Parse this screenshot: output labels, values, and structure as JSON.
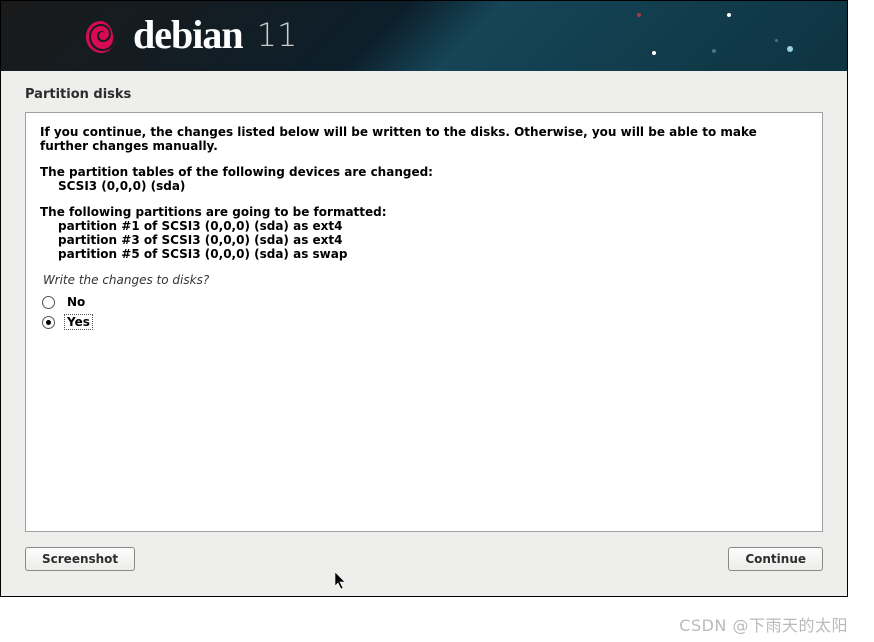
{
  "brand": {
    "name": "debian",
    "version": "11"
  },
  "page": {
    "title": "Partition disks"
  },
  "panel": {
    "warning": "If you continue, the changes listed below will be written to the disks. Otherwise, you will be able to make further changes manually.",
    "tables_heading": "The partition tables of the following devices are changed:",
    "tables": [
      "SCSI3 (0,0,0) (sda)"
    ],
    "format_heading": "The following partitions are going to be formatted:",
    "format_items": [
      "partition #1 of SCSI3 (0,0,0) (sda) as ext4",
      "partition #3 of SCSI3 (0,0,0) (sda) as ext4",
      "partition #5 of SCSI3 (0,0,0) (sda) as swap"
    ],
    "question": "Write the changes to disks?",
    "options": {
      "no": "No",
      "yes": "Yes"
    },
    "selected": "yes"
  },
  "buttons": {
    "screenshot": "Screenshot",
    "continue": "Continue"
  },
  "watermark": "CSDN @下雨天的太阳"
}
